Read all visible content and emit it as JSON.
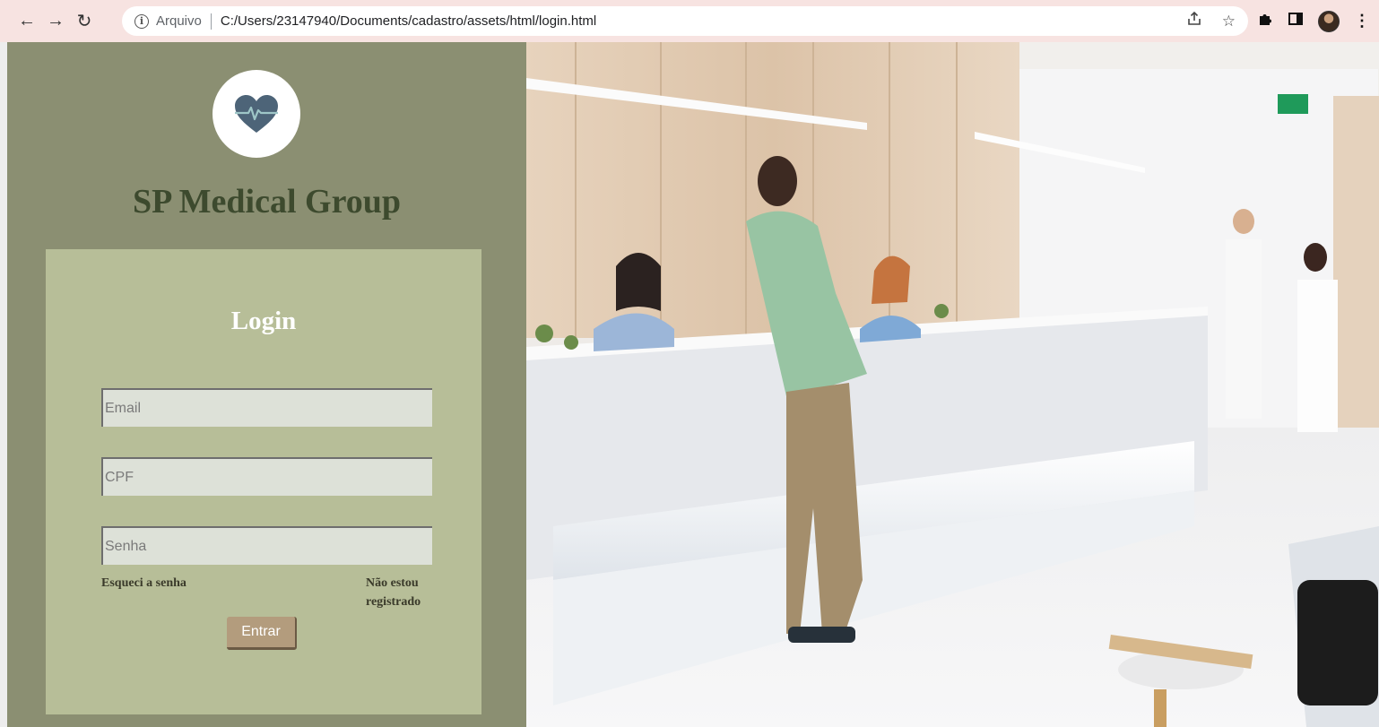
{
  "browser": {
    "scheme_label": "Arquivo",
    "url": "C:/Users/23147940/Documents/cadastro/assets/html/login.html",
    "icons": [
      "back-arrow-icon",
      "forward-arrow-icon",
      "reload-icon",
      "info-icon",
      "share-icon",
      "star-icon",
      "puzzle-icon",
      "sidebar-icon",
      "profile-avatar",
      "more-menu-icon"
    ]
  },
  "sidebar": {
    "brand": "SP Medical Group",
    "logo_icon": "heart-pulse-icon"
  },
  "login": {
    "title": "Login",
    "email_placeholder": "Email",
    "cpf_placeholder": "CPF",
    "password_placeholder": "Senha",
    "forgot_label": "Esqueci a senha",
    "register_label": "Não estou registrado",
    "submit_label": "Entrar"
  },
  "colors": {
    "panel": "#8b8f72",
    "card": "#b7be98",
    "brand_text": "#3d4a2e",
    "button": "#b39c7d",
    "chrome": "#f7e3e1"
  }
}
